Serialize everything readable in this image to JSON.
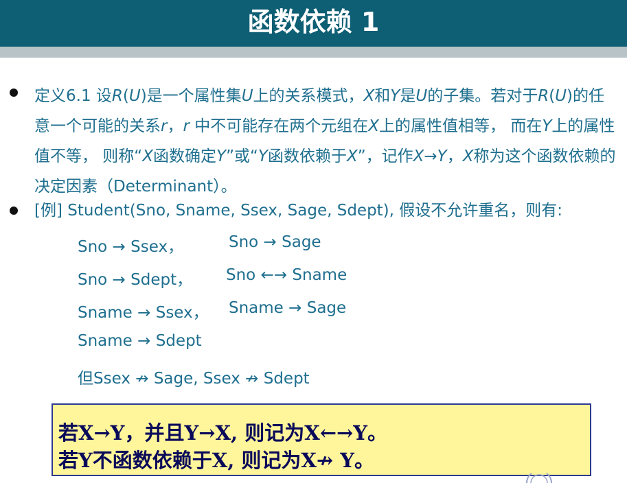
{
  "header": {
    "title": "函数依赖 1"
  },
  "definition": {
    "seg1": "定义6.1  设",
    "r1": "R",
    "seg2": "(",
    "u1": "U",
    "seg3": ")是一个属性集",
    "u2": "U",
    "seg4": "上的关系模式，",
    "x1": "X",
    "seg5": "和",
    "y1": "Y",
    "seg6": "是",
    "u3": "U",
    "seg7": "的子集。若对于",
    "r2": "R",
    "seg8": "(",
    "u4": "U",
    "seg9": ")的任意一个可能的关系",
    "r3": "r",
    "seg10": "，",
    "r4": "r",
    "seg11": " 中不可能存在两个元组在",
    "x2": "X",
    "seg12": "上的属性值相等， 而在",
    "y2": "Y",
    "seg13": "上的属性值不等， 则称“",
    "x3": "X",
    "seg14": "函数确定",
    "y3": "Y",
    "seg15": "”或“",
    "y4": "Y",
    "seg16": "函数依赖于",
    "x4": "X",
    "seg17": "”，记作",
    "x5": "X→Y",
    "seg18": "，",
    "x6": "X",
    "seg19": "称为这个函数依赖的决定因素（Determinant）。"
  },
  "example": {
    "text": "[例] Student(Sno, Sname, Ssex, Sage, Sdept), 假设不允许重名，则有:",
    "deps": [
      "Sno → Ssex，",
      "Sno → Sage",
      "Sno → Sdept，",
      "Sno ←→ Sname",
      "Sname → Ssex，",
      "Sname → Sage",
      "Sname → Sdept",
      "但Ssex ↛  Sage, Ssex ↛  Sdept"
    ]
  },
  "note": {
    "line1": "若X→Y，并且Y→X, 则记为X←→Y。",
    "line2": "若Y不函数依赖于X, 则记为X↛ Y。"
  }
}
